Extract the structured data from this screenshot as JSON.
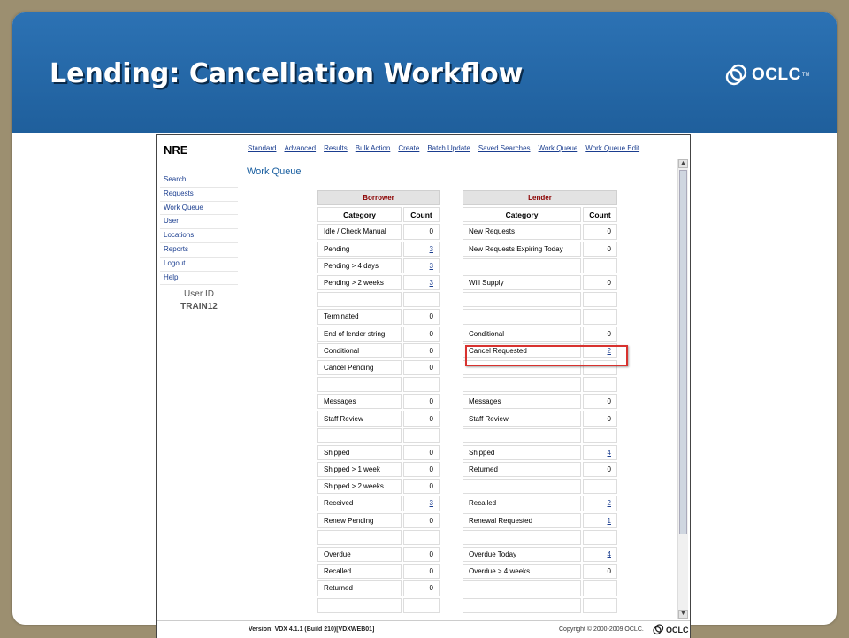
{
  "slide": {
    "title": "Lending: Cancellation Workflow",
    "logo_text": "OCLC",
    "logo_tm": "TM",
    "accent": "#2468ab"
  },
  "app": {
    "brand": "NRE",
    "topnav": [
      "Standard",
      "Advanced",
      "Results",
      "Bulk Action",
      "Create",
      "Batch Update",
      "Saved Searches",
      "Work Queue",
      "Work Queue Edit"
    ],
    "sidenav": [
      "Search",
      "Requests",
      "Work Queue",
      "User",
      "Locations",
      "Reports",
      "Logout",
      "Help"
    ],
    "user_id_label": "User ID",
    "user_id": "TRAIN12",
    "page_title": "Work Queue",
    "borrower": {
      "title": "Borrower",
      "col_category": "Category",
      "col_count": "Count",
      "rows": [
        {
          "category": "Idle / Check Manual",
          "count": "0",
          "link": false
        },
        {
          "category": "Pending",
          "count": "3",
          "link": true
        },
        {
          "category": "Pending > 4 days",
          "count": "3",
          "link": true
        },
        {
          "category": "Pending > 2 weeks",
          "count": "3",
          "link": true
        },
        {
          "category": "",
          "count": "",
          "link": false
        },
        {
          "category": "Terminated",
          "count": "0",
          "link": false
        },
        {
          "category": "End of lender string",
          "count": "0",
          "link": false
        },
        {
          "category": "Conditional",
          "count": "0",
          "link": false
        },
        {
          "category": "Cancel Pending",
          "count": "0",
          "link": false
        },
        {
          "category": "",
          "count": "",
          "link": false
        },
        {
          "category": "Messages",
          "count": "0",
          "link": false
        },
        {
          "category": "Staff Review",
          "count": "0",
          "link": false
        },
        {
          "category": "",
          "count": "",
          "link": false
        },
        {
          "category": "Shipped",
          "count": "0",
          "link": false
        },
        {
          "category": "Shipped > 1 week",
          "count": "0",
          "link": false
        },
        {
          "category": "Shipped > 2 weeks",
          "count": "0",
          "link": false
        },
        {
          "category": "Received",
          "count": "3",
          "link": true
        },
        {
          "category": "Renew Pending",
          "count": "0",
          "link": false
        },
        {
          "category": "",
          "count": "",
          "link": false
        },
        {
          "category": "Overdue",
          "count": "0",
          "link": false
        },
        {
          "category": "Recalled",
          "count": "0",
          "link": false
        },
        {
          "category": "Returned",
          "count": "0",
          "link": false
        },
        {
          "category": "",
          "count": "",
          "link": false
        }
      ]
    },
    "lender": {
      "title": "Lender",
      "col_category": "Category",
      "col_count": "Count",
      "rows": [
        {
          "category": "New Requests",
          "count": "0",
          "link": false
        },
        {
          "category": "New Requests Expiring Today",
          "count": "0",
          "link": false
        },
        {
          "category": "",
          "count": "",
          "link": false
        },
        {
          "category": "Will Supply",
          "count": "0",
          "link": false
        },
        {
          "category": "",
          "count": "",
          "link": false
        },
        {
          "category": "",
          "count": "",
          "link": false
        },
        {
          "category": "Conditional",
          "count": "0",
          "link": false
        },
        {
          "category": "Cancel Requested",
          "count": "2",
          "link": true
        },
        {
          "category": "",
          "count": "",
          "link": false
        },
        {
          "category": "",
          "count": "",
          "link": false
        },
        {
          "category": "Messages",
          "count": "0",
          "link": false
        },
        {
          "category": "Staff Review",
          "count": "0",
          "link": false
        },
        {
          "category": "",
          "count": "",
          "link": false
        },
        {
          "category": "Shipped",
          "count": "4",
          "link": true
        },
        {
          "category": "Returned",
          "count": "0",
          "link": false
        },
        {
          "category": "",
          "count": "",
          "link": false
        },
        {
          "category": "Recalled",
          "count": "2",
          "link": true
        },
        {
          "category": "Renewal Requested",
          "count": "1",
          "link": true
        },
        {
          "category": "",
          "count": "",
          "link": false
        },
        {
          "category": "Overdue Today",
          "count": "4",
          "link": true
        },
        {
          "category": "Overdue > 4 weeks",
          "count": "0",
          "link": false
        },
        {
          "category": "",
          "count": "",
          "link": false
        },
        {
          "category": "",
          "count": "",
          "link": false
        }
      ]
    },
    "footer": {
      "version": "Version: VDX 4.1.1 (Build 210)[VDXWEB01]",
      "copyright": "Copyright © 2000-2009 OCLC.",
      "logo_text": "OCLC"
    }
  }
}
